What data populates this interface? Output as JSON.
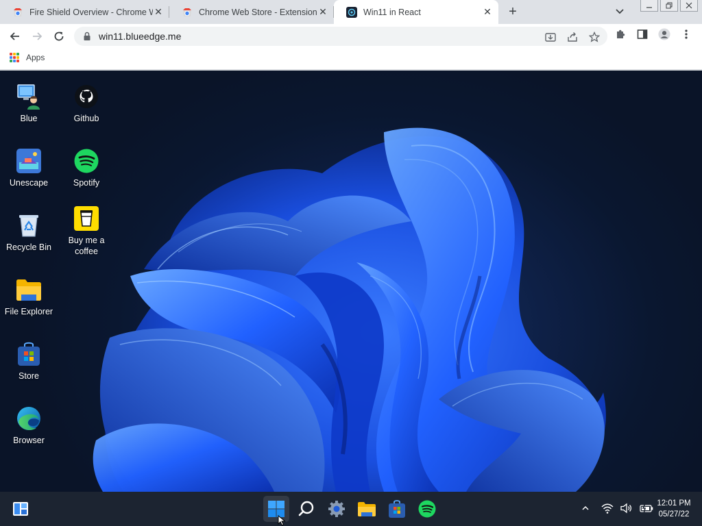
{
  "browser": {
    "tabs": [
      {
        "title": "Fire Shield Overview - Chrome W",
        "active": false
      },
      {
        "title": "Chrome Web Store - Extensions",
        "active": false
      },
      {
        "title": "Win11 in React",
        "active": true
      }
    ],
    "close_glyph": "✕",
    "new_tab_glyph": "+",
    "address": "win11.blueedge.me",
    "bookmarks": {
      "apps_label": "Apps"
    }
  },
  "desktop": {
    "icons": [
      {
        "label": "Blue",
        "icon": "user-computer-icon"
      },
      {
        "label": "Github",
        "icon": "github-icon"
      },
      {
        "label": "Unescape",
        "icon": "unescape-icon"
      },
      {
        "label": "Spotify",
        "icon": "spotify-icon"
      },
      {
        "label": "Recycle Bin",
        "icon": "recycle-bin-icon"
      },
      {
        "label": "Buy me a coffee",
        "icon": "coffee-cup-icon"
      },
      {
        "label": "File Explorer",
        "icon": "folder-icon"
      },
      {
        "label": "Store",
        "icon": "store-icon"
      },
      {
        "label": "Browser",
        "icon": "edge-icon"
      }
    ]
  },
  "taskbar": {
    "apps": [
      "start-icon",
      "search-icon",
      "settings-icon",
      "file-explorer-icon",
      "store-icon",
      "spotify-icon"
    ],
    "clock": {
      "time": "12:01 PM",
      "date": "05/27/22"
    }
  },
  "colors": {
    "taskbar": "#1c2431",
    "windows_blue": "#1e90ff",
    "spotify_green": "#1ed760",
    "chrome_tab_bg": "#dee1e6"
  }
}
